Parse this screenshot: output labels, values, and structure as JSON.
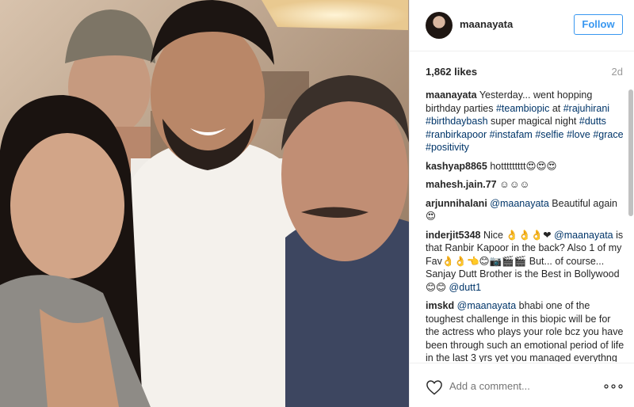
{
  "post": {
    "username": "maanayata",
    "follow_label": "Follow",
    "likes": "1,862 likes",
    "age": "2d"
  },
  "caption": {
    "user": "maanayata",
    "parts": [
      {
        "text": " Yesterday... went hopping birthday parties ",
        "tag": false
      },
      {
        "text": "#teambiopic",
        "tag": true
      },
      {
        "text": " at ",
        "tag": false
      },
      {
        "text": "#rajuhirani",
        "tag": true
      },
      {
        "text": " ",
        "tag": false
      },
      {
        "text": "#birthdaybash",
        "tag": true
      },
      {
        "text": " super magical night ",
        "tag": false
      },
      {
        "text": "#dutts",
        "tag": true
      },
      {
        "text": " ",
        "tag": false
      },
      {
        "text": "#ranbirkapoor",
        "tag": true
      },
      {
        "text": " ",
        "tag": false
      },
      {
        "text": "#instafam",
        "tag": true
      },
      {
        "text": " ",
        "tag": false
      },
      {
        "text": "#selfie",
        "tag": true
      },
      {
        "text": " ",
        "tag": false
      },
      {
        "text": "#love",
        "tag": true
      },
      {
        "text": " ",
        "tag": false
      },
      {
        "text": "#grace",
        "tag": true
      },
      {
        "text": " ",
        "tag": false
      },
      {
        "text": "#positivity",
        "tag": true
      }
    ]
  },
  "comments": [
    {
      "user": "kashyap8865",
      "parts": [
        {
          "text": " hottttttttt😍😍😍",
          "tag": false
        }
      ]
    },
    {
      "user": "mahesh.jain.77",
      "parts": [
        {
          "text": " ☺☺☺",
          "tag": false
        }
      ]
    },
    {
      "user": "arjunnihalani",
      "parts": [
        {
          "text": " ",
          "tag": false
        },
        {
          "text": "@maanayata",
          "tag": true
        },
        {
          "text": " Beautiful again 😍",
          "tag": false
        }
      ]
    },
    {
      "user": "inderjit5348",
      "parts": [
        {
          "text": " Nice 👌👌👌❤ ",
          "tag": false
        },
        {
          "text": "@maanayata",
          "tag": true
        },
        {
          "text": " is that Ranbir Kapoor in the back? Also 1 of my Fav👌👌👈😊📷🎬🎬 But... of course... Sanjay Dutt Brother is the Best in Bollywood 😊😊 ",
          "tag": false
        },
        {
          "text": "@dutt1",
          "tag": true
        }
      ]
    },
    {
      "user": "imskd",
      "parts": [
        {
          "text": " ",
          "tag": false
        },
        {
          "text": "@maanayata",
          "tag": true
        },
        {
          "text": " bhabi one of the toughest challenge in this biopic will be for the actress who plays your role bcz you have been through such an emotional period of life in the last 3 yrs yet you managed everythng amazingly,",
          "tag": false
        }
      ]
    }
  ],
  "footer": {
    "comment_placeholder": "Add a comment...",
    "icons": {
      "like": "heart-icon",
      "more": "more-options-icon"
    }
  },
  "colors": {
    "accent": "#3897f0",
    "hashtag": "#003569",
    "muted": "#999999"
  }
}
